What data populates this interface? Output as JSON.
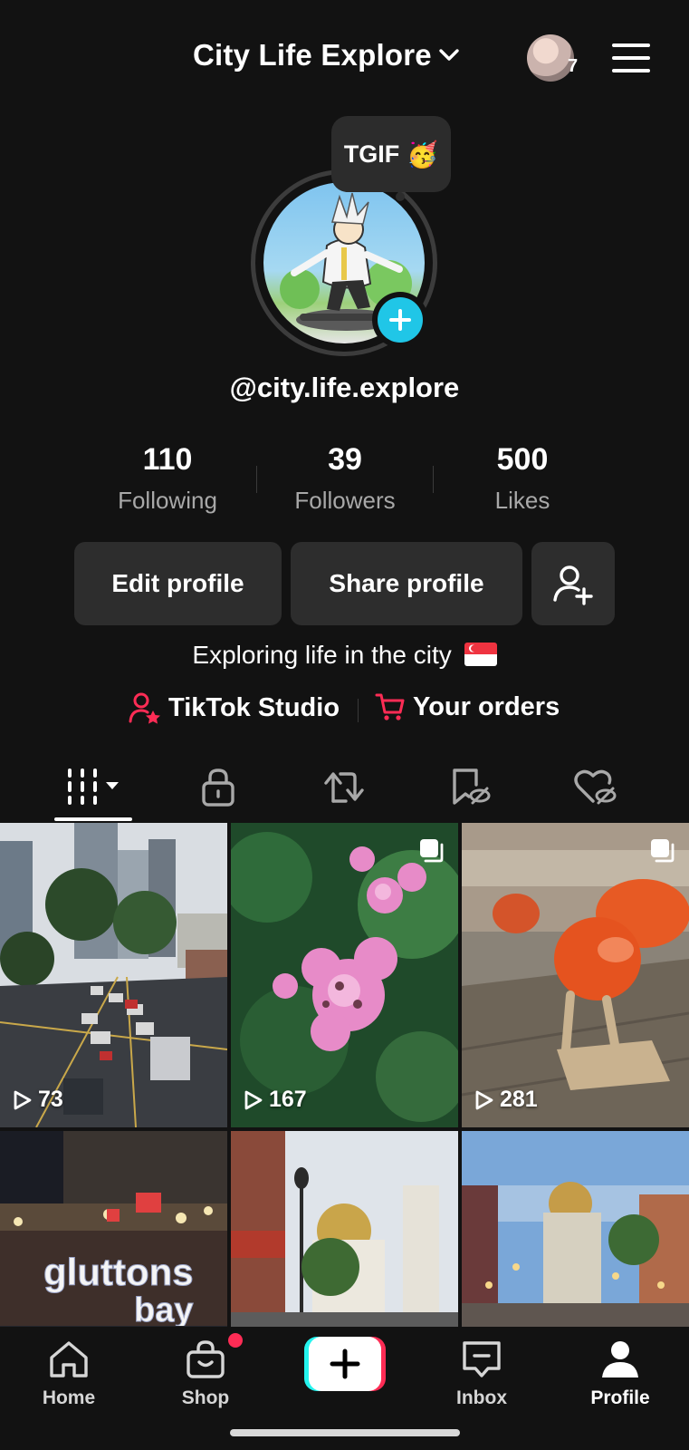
{
  "header": {
    "account_name": "City Life Explore",
    "notification_count": "7"
  },
  "avatar": {
    "note_text": "TGIF",
    "note_emoji": "🥳"
  },
  "profile": {
    "username": "@city.life.explore",
    "bio": "Exploring life in the city",
    "bio_flag": "singapore-flag-icon"
  },
  "stats": [
    {
      "value": "110",
      "label": "Following"
    },
    {
      "value": "39",
      "label": "Followers"
    },
    {
      "value": "500",
      "label": "Likes"
    }
  ],
  "actions": {
    "edit_profile": "Edit profile",
    "share_profile": "Share profile"
  },
  "links": [
    {
      "label": "TikTok Studio",
      "icon": "person-star-icon"
    },
    {
      "label": "Your orders",
      "icon": "cart-icon"
    }
  ],
  "tabs": [
    {
      "icon": "grid-icon",
      "active": true
    },
    {
      "icon": "lock-icon",
      "active": false
    },
    {
      "icon": "repost-icon",
      "active": false
    },
    {
      "icon": "bookmark-icon",
      "active": false
    },
    {
      "icon": "heart-icon",
      "active": false
    }
  ],
  "videos": [
    {
      "views": "73",
      "multi": false,
      "scene": "city-traffic"
    },
    {
      "views": "167",
      "multi": true,
      "scene": "pink-flowers"
    },
    {
      "views": "281",
      "multi": true,
      "scene": "orange-sculpture"
    },
    {
      "views": "",
      "multi": false,
      "scene": "gluttons-bay-night"
    },
    {
      "views": "",
      "multi": false,
      "scene": "mosque-street"
    },
    {
      "views": "",
      "multi": false,
      "scene": "mosque-dusk"
    }
  ],
  "bottom_nav": [
    {
      "label": "Home",
      "icon": "home-icon"
    },
    {
      "label": "Shop",
      "icon": "shop-bag-icon"
    },
    {
      "label": "",
      "icon": "create-plus-icon"
    },
    {
      "label": "Inbox",
      "icon": "inbox-icon"
    },
    {
      "label": "Profile",
      "icon": "profile-icon"
    }
  ],
  "colors": {
    "background": "#121212",
    "button": "#2d2d2d",
    "accent_cyan": "#20c6e7",
    "accent_red": "#fe2c55",
    "secondary_text": "#a8a8a8"
  }
}
